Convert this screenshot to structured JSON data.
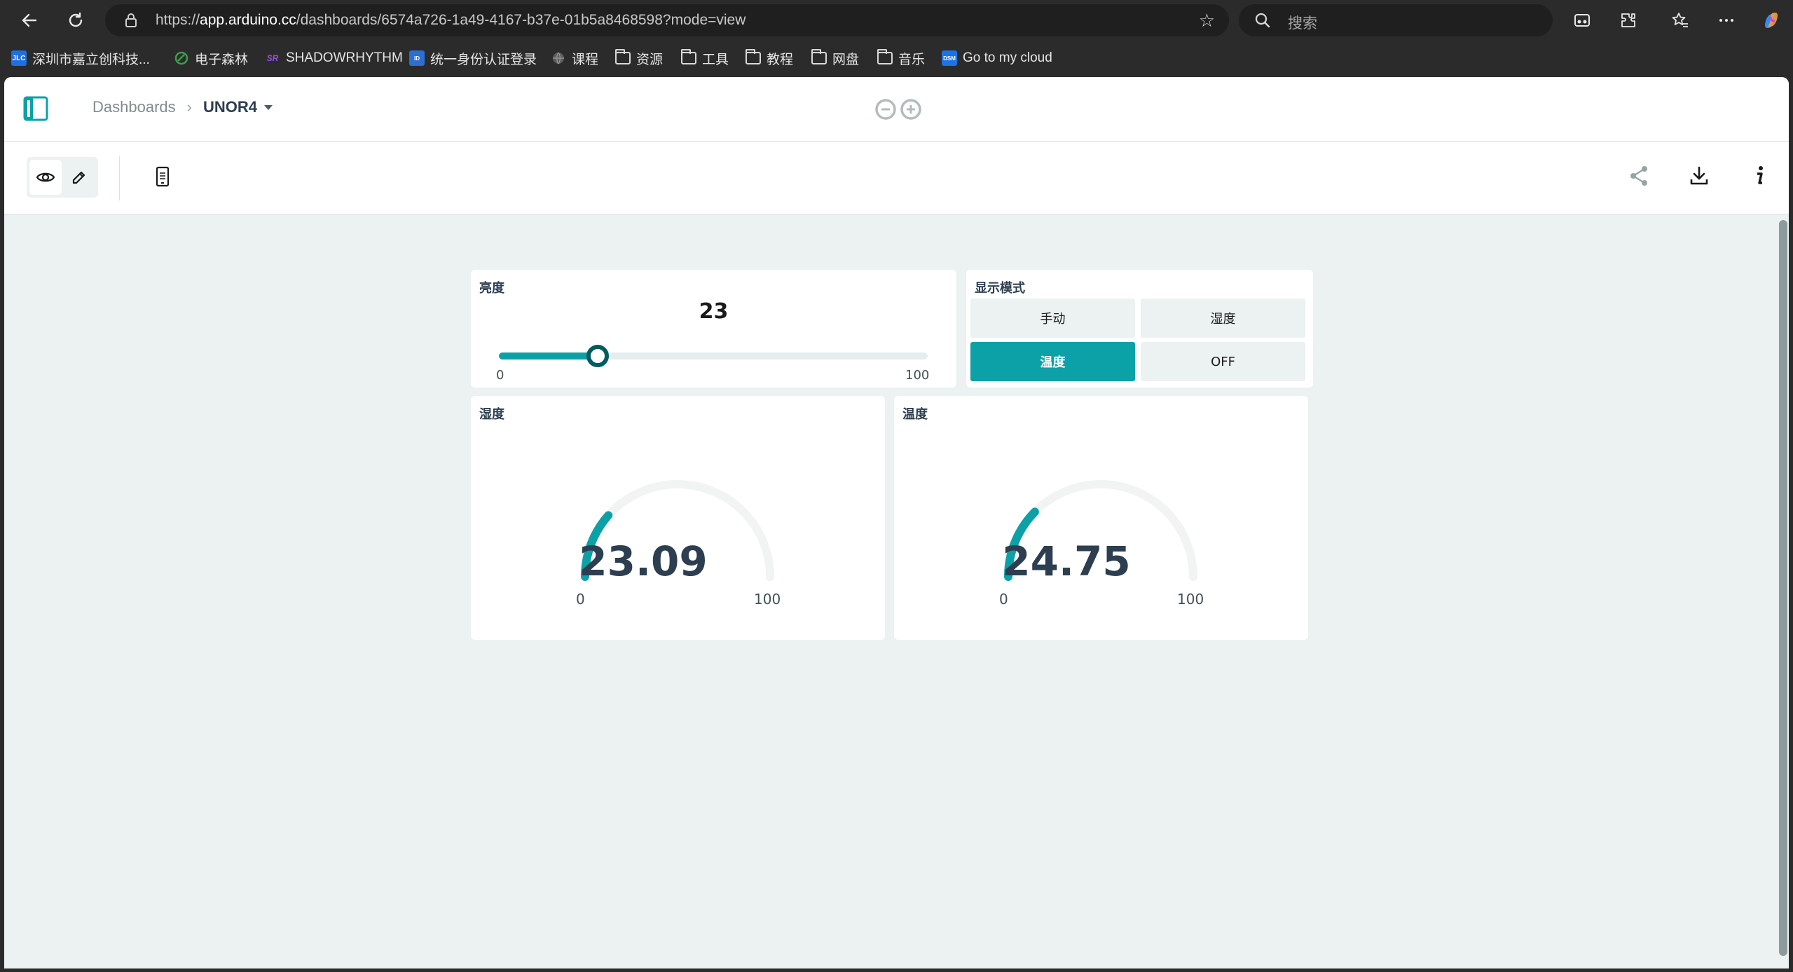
{
  "browser": {
    "url_prefix": "https://",
    "url_host": "app.arduino.cc",
    "url_path": "/dashboards/6574a726-1a49-4167-b37e-01b5a8468598?mode=view",
    "search_placeholder": "搜索"
  },
  "bookmarks": [
    {
      "label": "深圳市嘉立创科技...",
      "icon": "JLC",
      "color": "#1f6fe0"
    },
    {
      "label": "电子森林",
      "icon": "leaf",
      "color": "#3aa04a"
    },
    {
      "label": "SHADOWRHYTHM",
      "icon": "SR",
      "color": "#8a3ad6"
    },
    {
      "label": "统一身份认证登录",
      "icon": "ID",
      "color": "#2a6fd1"
    },
    {
      "label": "课程",
      "icon": "globe"
    },
    {
      "label": "资源",
      "icon": "folder"
    },
    {
      "label": "工具",
      "icon": "folder"
    },
    {
      "label": "教程",
      "icon": "folder"
    },
    {
      "label": "网盘",
      "icon": "folder"
    },
    {
      "label": "音乐",
      "icon": "folder"
    },
    {
      "label": "Go to my cloud",
      "icon": "DSM",
      "color": "#1c73e6"
    }
  ],
  "header": {
    "breadcrumb_root": "Dashboards",
    "breadcrumb_sep": "›",
    "dashboard_name": "UNOR4"
  },
  "widgets": {
    "slider": {
      "title": "亮度",
      "value": 23,
      "min": 0,
      "max": 100,
      "min_label": "0",
      "max_label": "100"
    },
    "switch": {
      "title": "显示模式",
      "options": [
        "手动",
        "湿度",
        "温度",
        "OFF"
      ],
      "selected": "温度"
    },
    "gauge1": {
      "title": "湿度",
      "value": 23.09,
      "value_label": "23.09",
      "min": 0,
      "max": 100,
      "min_label": "0",
      "max_label": "100"
    },
    "gauge2": {
      "title": "温度",
      "value": 24.75,
      "value_label": "24.75",
      "min": 0,
      "max": 100,
      "min_label": "0",
      "max_label": "100"
    }
  },
  "colors": {
    "accent": "#0ca1a6",
    "thumb_border": "#005c5f",
    "track": "#e6eded",
    "background": "#ecf1f1"
  }
}
